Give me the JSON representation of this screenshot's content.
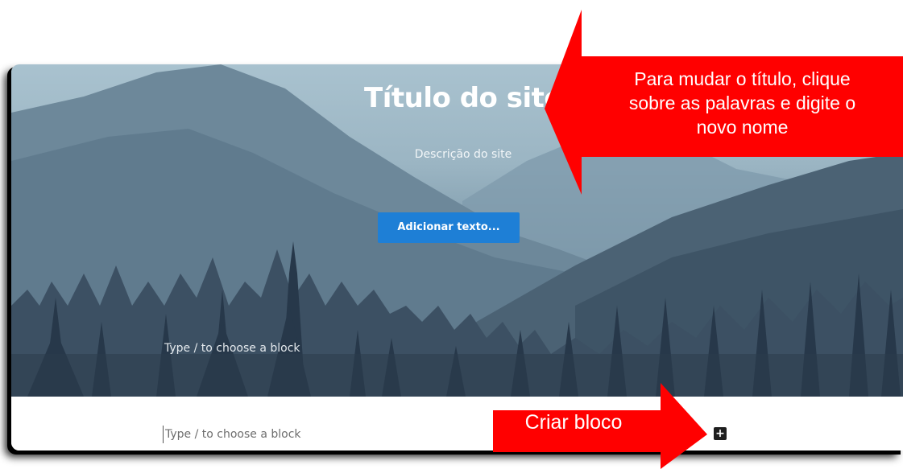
{
  "hero": {
    "site_title": "Título do site",
    "site_description": "Descrição do site",
    "add_text_button": "Adicionar texto...",
    "block_placeholder": "Type / to choose a block"
  },
  "editor": {
    "block_placeholder": "Type / to choose a block",
    "add_block_icon": "plus-icon"
  },
  "annotations": {
    "title_hint": "Para mudar o título, clique sobre as palavras e digite o novo nome",
    "title_hint_lines": [
      "Para mudar o título, clique",
      "sobre as palavras e digite o",
      "novo nome"
    ],
    "create_block_hint": "Criar bloco",
    "arrow_color": "#ff0000"
  },
  "colors": {
    "button_blue": "#1e7fd6",
    "sky": "#a9c2cf",
    "forest": "#2c3d4c"
  }
}
